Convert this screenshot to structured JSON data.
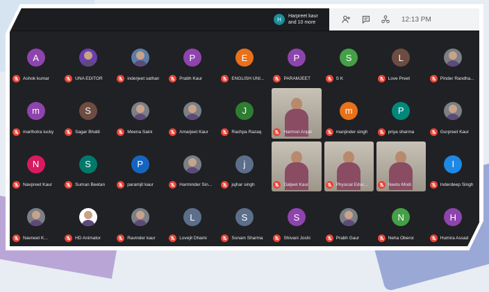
{
  "topbar": {
    "presenter_initial": "H",
    "presenter_line1": "Harpreet kaur",
    "presenter_line2": "and 10 more",
    "clock": "12:13 PM",
    "icons": [
      "people-icon",
      "chat-icon",
      "activities-icon"
    ]
  },
  "colors": {
    "muted_mic": "#ea4335",
    "background": "#202124"
  },
  "tiles": [
    {
      "name": "Ashok kumar",
      "initial": "A",
      "color": "#8e44ad",
      "kind": "avatar"
    },
    {
      "name": "UNA EDITOR",
      "initial": "",
      "color": "#6a3fb0",
      "kind": "photo"
    },
    {
      "name": "inderjeet sathan",
      "initial": "",
      "color": "#5a7ea8",
      "kind": "photo"
    },
    {
      "name": "Prabh Kaur",
      "initial": "P",
      "color": "#8e44ad",
      "kind": "avatar"
    },
    {
      "name": "ENGLISH UNI...",
      "initial": "E",
      "color": "#e8711a",
      "kind": "avatar"
    },
    {
      "name": "PARAMJEET",
      "initial": "P",
      "color": "#8e44ad",
      "kind": "avatar"
    },
    {
      "name": "S K",
      "initial": "S",
      "color": "#43a047",
      "kind": "avatar"
    },
    {
      "name": "Love Preet",
      "initial": "L",
      "color": "#6d4c41",
      "kind": "avatar"
    },
    {
      "name": "Pinder Randha...",
      "initial": "",
      "color": "#7b7f86",
      "kind": "photo"
    },
    {
      "name": "marlhotra lucky",
      "initial": "m",
      "color": "#8e44ad",
      "kind": "avatar"
    },
    {
      "name": "Sagar Bhatti",
      "initial": "S",
      "color": "#6d4c41",
      "kind": "avatar"
    },
    {
      "name": "Meena Saini",
      "initial": "",
      "color": "#7b7f86",
      "kind": "photo"
    },
    {
      "name": "Amarjeet Kaur",
      "initial": "",
      "color": "#7b7f86",
      "kind": "photo"
    },
    {
      "name": "Rachpa Razaq",
      "initial": "J",
      "color": "#2e7d32",
      "kind": "avatar"
    },
    {
      "name": "Harmon Anjali",
      "initial": "",
      "color": "#7b7f86",
      "kind": "video"
    },
    {
      "name": "manjinder singh",
      "initial": "m",
      "color": "#e8711a",
      "kind": "avatar"
    },
    {
      "name": "priya sharma",
      "initial": "P",
      "color": "#00897b",
      "kind": "avatar"
    },
    {
      "name": "Gurpreet Kaur",
      "initial": "",
      "color": "#7b7f86",
      "kind": "photo"
    },
    {
      "name": "Navpreet Kaur",
      "initial": "N",
      "color": "#d81b60",
      "kind": "avatar"
    },
    {
      "name": "Suman Beetan",
      "initial": "S",
      "color": "#00796b",
      "kind": "avatar"
    },
    {
      "name": "paramjit kaur",
      "initial": "P",
      "color": "#1565c0",
      "kind": "avatar"
    },
    {
      "name": "Harminder Sin...",
      "initial": "",
      "color": "#7b7f86",
      "kind": "photo"
    },
    {
      "name": "jujhar singh",
      "initial": "j",
      "color": "#5c6f8a",
      "kind": "avatar"
    },
    {
      "name": "Daljeet Kaur",
      "initial": "",
      "color": "#7b7f86",
      "kind": "video"
    },
    {
      "name": "Physical Educ...",
      "initial": "",
      "color": "#7b7f86",
      "kind": "video"
    },
    {
      "name": "Neetu Modi",
      "initial": "",
      "color": "#7b7f86",
      "kind": "video"
    },
    {
      "name": "Inderdeep Singh",
      "initial": "I",
      "color": "#1e88e5",
      "kind": "avatar"
    },
    {
      "name": "Navneet K...",
      "initial": "",
      "color": "#7b7f86",
      "kind": "photo"
    },
    {
      "name": "HD Animator",
      "initial": "",
      "color": "#ffffff",
      "kind": "photo"
    },
    {
      "name": "Ravinder kaur",
      "initial": "",
      "color": "#7b7f86",
      "kind": "photo"
    },
    {
      "name": "Lovejit Dhami",
      "initial": "L",
      "color": "#5c6f8a",
      "kind": "avatar"
    },
    {
      "name": "Sonam Sharma",
      "initial": "S",
      "color": "#5c6f8a",
      "kind": "avatar"
    },
    {
      "name": "Shivani Joshi",
      "initial": "S",
      "color": "#8e44ad",
      "kind": "avatar"
    },
    {
      "name": "Prabh Gaur",
      "initial": "",
      "color": "#7b7f86",
      "kind": "photo"
    },
    {
      "name": "Neha Oberoi",
      "initial": "N",
      "color": "#43a047",
      "kind": "avatar"
    },
    {
      "name": "Humira Assad",
      "initial": "H",
      "color": "#8e44ad",
      "kind": "avatar"
    }
  ]
}
